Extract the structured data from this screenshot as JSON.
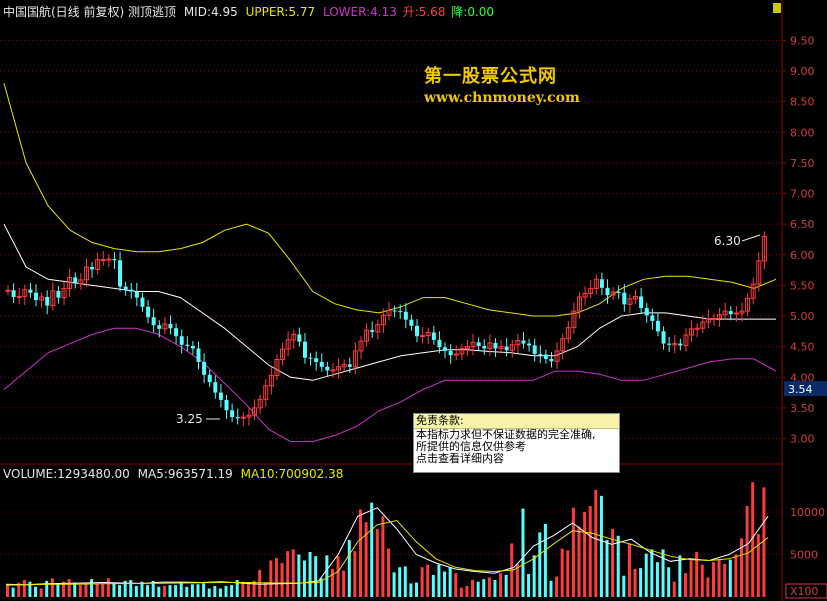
{
  "header": {
    "name": "中国国航(日线 前复权) 测顶逃顶",
    "mid": "MID:4.95",
    "upper": "UPPER:5.77",
    "lower": "LOWER:4.13",
    "rise": "升:5.68",
    "fall": "降:0.00"
  },
  "watermark": {
    "cn": "第一股票公式网",
    "url": "www.chnmoney.com"
  },
  "disclaimer": {
    "title": "免责条款:",
    "line1": "本指标力求但不保证数据的完全准确,",
    "line2": "所提供的信息仅供参考",
    "line3": "点击查看详细内容"
  },
  "volume_header": {
    "volume": "VOLUME:1293480.00",
    "ma5": "MA5:963571.19",
    "ma10": "MA10:700902.38"
  },
  "annotations": {
    "low": "3.25",
    "high": "6.30",
    "current": "3.54",
    "unit": "X100"
  },
  "colors": {
    "up": "#ff3c3c",
    "down": "#55ffff",
    "upper": "#e6e600",
    "mid": "#ffffff",
    "lower": "#cc33cc",
    "grid": "#8b0000"
  },
  "chart_data": {
    "type": "candlestick",
    "price_axis": {
      "ticks": [
        3.0,
        3.5,
        4.0,
        4.5,
        5.0,
        5.5,
        6.0,
        6.5,
        7.0,
        7.5,
        8.0,
        8.5,
        9.0,
        9.5
      ],
      "ylim": [
        2.6,
        9.8
      ]
    },
    "volume_axis": {
      "ticks": [
        5000,
        10000
      ],
      "ylim": [
        0,
        14000
      ]
    },
    "candles_close": [
      5.42,
      5.31,
      5.32,
      5.43,
      5.38,
      5.26,
      5.31,
      5.17,
      5.41,
      5.3,
      5.45,
      5.63,
      5.53,
      5.59,
      5.8,
      5.76,
      5.92,
      5.92,
      5.93,
      5.91,
      5.48,
      5.43,
      5.4,
      5.3,
      5.15,
      4.98,
      4.85,
      4.79,
      4.87,
      4.8,
      4.67,
      4.53,
      4.51,
      4.47,
      4.25,
      4.04,
      3.92,
      3.75,
      3.63,
      3.46,
      3.35,
      3.33,
      3.35,
      3.38,
      3.5,
      3.64,
      3.86,
      4.03,
      4.29,
      4.46,
      4.61,
      4.7,
      4.58,
      4.32,
      4.31,
      4.25,
      4.17,
      4.11,
      4.12,
      4.17,
      4.21,
      4.17,
      4.43,
      4.59,
      4.77,
      4.74,
      4.86,
      5.01,
      5.09,
      5.08,
      5.07,
      4.94,
      4.84,
      4.67,
      4.68,
      4.73,
      4.61,
      4.49,
      4.43,
      4.36,
      4.38,
      4.47,
      4.5,
      4.57,
      4.51,
      4.47,
      4.56,
      4.47,
      4.5,
      4.44,
      4.53,
      4.6,
      4.55,
      4.52,
      4.38,
      4.37,
      4.3,
      4.26,
      4.43,
      4.63,
      4.81,
      5.08,
      5.31,
      5.37,
      5.45,
      5.6,
      5.46,
      5.34,
      5.39,
      5.38,
      5.19,
      5.28,
      5.32,
      5.13,
      5.01,
      4.92,
      4.75,
      4.55,
      4.53,
      4.55,
      4.52,
      4.69,
      4.79,
      4.8,
      4.9,
      4.96,
      4.96,
      5.02,
      5.08,
      5.03,
      5.05,
      5.08,
      5.29,
      5.52,
      5.9,
      6.3
    ],
    "bands": {
      "upper": [
        8.8,
        7.5,
        6.8,
        6.4,
        6.2,
        6.1,
        6.05,
        6.05,
        6.1,
        6.2,
        6.4,
        6.5,
        6.35,
        5.9,
        5.4,
        5.2,
        5.1,
        5.05,
        5.15,
        5.3,
        5.3,
        5.2,
        5.1,
        5.05,
        5.0,
        5.0,
        5.05,
        5.2,
        5.45,
        5.6,
        5.65,
        5.65,
        5.6,
        5.55,
        5.45,
        5.6
      ],
      "mid": [
        6.5,
        5.8,
        5.6,
        5.55,
        5.5,
        5.45,
        5.4,
        5.4,
        5.3,
        5.05,
        4.8,
        4.5,
        4.2,
        4.0,
        3.95,
        4.05,
        4.15,
        4.25,
        4.35,
        4.4,
        4.45,
        4.45,
        4.42,
        4.4,
        4.35,
        4.35,
        4.5,
        4.8,
        5.0,
        5.05,
        5.05,
        5.0,
        4.95,
        4.95,
        4.95,
        4.95
      ],
      "lower": [
        3.8,
        4.1,
        4.4,
        4.55,
        4.7,
        4.8,
        4.8,
        4.7,
        4.5,
        4.25,
        3.9,
        3.55,
        3.15,
        2.95,
        2.95,
        3.05,
        3.2,
        3.45,
        3.6,
        3.8,
        3.95,
        3.95,
        3.95,
        3.95,
        3.95,
        4.1,
        4.1,
        4.05,
        3.95,
        3.95,
        4.05,
        4.15,
        4.25,
        4.3,
        4.3,
        4.1
      ]
    },
    "volume": [
      1500,
      1100,
      1700,
      2000,
      1800,
      1200,
      1000,
      1900,
      2200,
      1600,
      1800,
      2100,
      1700,
      1400,
      1500,
      2100,
      1600,
      1500,
      2200,
      1700,
      1400,
      1900,
      2000,
      1300,
      1800,
      1400,
      1900,
      1200,
      1300,
      1400,
      1400,
      1800,
      1200,
      1500,
      1500,
      1600,
      1000,
      1300,
      1000,
      1300,
      1400,
      2000,
      1800,
      1700,
      1900,
      3200,
      1700,
      4300,
      4600,
      4000,
      5400,
      5600,
      5000,
      4300,
      5300,
      4800,
      2200,
      4900,
      3300,
      4800,
      3100,
      6700,
      5400,
      10300,
      8800,
      11100,
      8000,
      9500,
      5700,
      2900,
      3500,
      3600,
      1600,
      1700,
      3500,
      3800,
      2600,
      3800,
      3000,
      3500,
      2800,
      1100,
      1300,
      2000,
      1800,
      2100,
      2300,
      2000,
      2800,
      2600,
      6300,
      3900,
      10400,
      2700,
      4900,
      7600,
      8600,
      1900,
      2400,
      5700,
      5500,
      10500,
      8300,
      10000,
      10700,
      12600,
      11900,
      6700,
      8000,
      7200,
      2500,
      6300,
      3300,
      3400,
      5100,
      5600,
      4100,
      5600,
      3500,
      1800,
      4900,
      2800,
      4300,
      5300,
      3800,
      2300,
      4100,
      4400,
      3900,
      4400,
      5000,
      6900,
      10700,
      13500,
      7400,
      12900
    ],
    "ma5": [
      1500,
      1450,
      1550,
      1600,
      1650,
      1700,
      1650,
      1600,
      1750,
      1750,
      1700,
      1800,
      1650,
      1500,
      1550,
      1600,
      1900,
      5000,
      9500,
      10500,
      8000,
      5000,
      4000,
      3300,
      3000,
      2800,
      3500,
      6000,
      7200,
      8700,
      7000,
      6200,
      6800,
      5200,
      4200,
      4500,
      4300,
      5000,
      6300,
      9500
    ],
    "ma10": [
      1400,
      1420,
      1480,
      1500,
      1520,
      1560,
      1580,
      1600,
      1620,
      1650,
      1680,
      1700,
      1700,
      1680,
      1650,
      1650,
      1700,
      3000,
      6500,
      8500,
      9000,
      6500,
      4500,
      3500,
      3100,
      3000,
      3200,
      4500,
      6200,
      7800,
      7500,
      6800,
      6200,
      5500,
      4800,
      4400,
      4300,
      4500,
      5200,
      7000
    ]
  }
}
